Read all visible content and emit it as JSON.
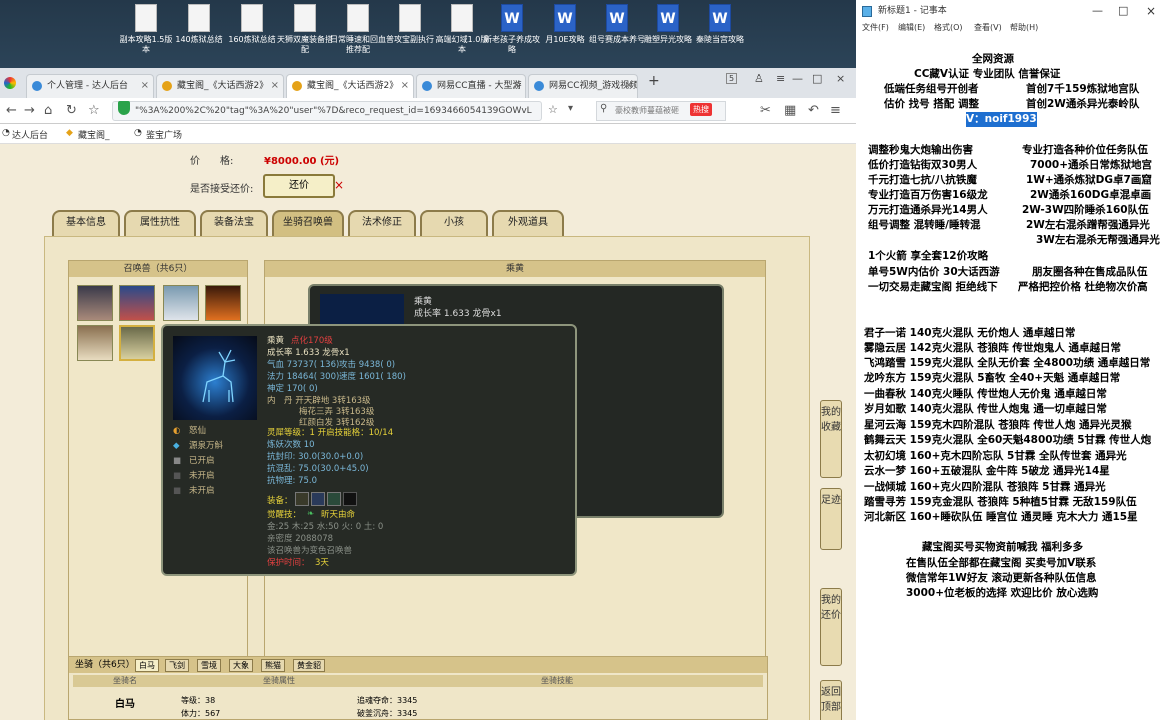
{
  "desktop": {
    "icons": [
      "副本攻略1.5版本",
      "140炼狱总结",
      "160炼狱总结",
      "天狮双魔装备搭配",
      "日常睡速和回血推荐配",
      "普攻宝副执行",
      "高端幻域1.0版本",
      "新老孩子养成攻略",
      "月10E攻略",
      "组号赛成本养号",
      "雕塑异光攻略",
      "秦陵当宫攻略"
    ]
  },
  "browser": {
    "tabs": [
      {
        "label": "个人管理 - 达人后台"
      },
      {
        "label": "藏宝阁_《大话西游2》"
      },
      {
        "label": "藏宝阁_《大话西游2》"
      },
      {
        "label": "网易CC直播 - 大型游"
      },
      {
        "label": "网易CC视频_游戏视频"
      }
    ],
    "tab_count": "5",
    "url": "\"%3A%200%2C%20\"tag\"%3A%20\"user\"%7D&reco_request_id=1693466054139GOWvL",
    "search_placeholder": "豪校教师蔓蕴被砸",
    "hot_badge": "热搜",
    "bookmarks": [
      "达人后台",
      "藏宝阁_",
      "鉴宝广场"
    ]
  },
  "page": {
    "price_label": "价　　格:",
    "price_value": "¥8000.00 (元)",
    "bargain_label": "是否接受还价:",
    "bargain_button": "还价",
    "tabs": [
      "基本信息",
      "属性抗性",
      "装备法宝",
      "坐骑召唤兽",
      "法术修正",
      "小孩",
      "外观道具"
    ],
    "pets_header": "召唤兽（共6只）",
    "detail_header": "乘黄",
    "tooltip_back": {
      "name": "乘黄",
      "growth": "成长率 1.633 龙骨x1"
    },
    "tooltip": {
      "name": "乘黄",
      "level": "点化170级",
      "growth": "成长率 1.633 龙骨x1",
      "hp": "气血 73737( 136)",
      "atk": "攻击 9438( 0)",
      "mp": "法力 18464( 300)",
      "spd": "速度 1601( 180)",
      "loyal": "神定 170( 0)",
      "neidan1": "内　丹 开天辟地 3转163级",
      "neidan2": "梅花三弄 3转163级",
      "neidan3": "红颜白发 3转162级",
      "skill1": "怒仙",
      "skill2": "源泉万斛",
      "skill3": "已开启",
      "skill4": "未开启",
      "skill5": "未开启",
      "lingxi": "灵犀等级：1 开启技能格：10/14",
      "lianyao": "炼妖次数 10",
      "kfy": "抗封印: 30.0(30.0+0.0)",
      "khl": "抗混乱: 75.0(30.0+45.0)",
      "kwl": "抗物理: 75.0",
      "equip": "装备：",
      "awaken": "觉醒技：",
      "awaken_skill": "昕天由命",
      "elements": "金:25 木:25 水:50 火: 0 土: 0",
      "qinmi": "亲密度 2088078",
      "note": "该召唤兽为变色召唤兽",
      "protect": "保护时间：",
      "protect_days": "3天"
    },
    "side_buttons": [
      "我的收藏",
      "足迹",
      "我的还价",
      "返回顶部"
    ],
    "mounts": {
      "header": "坐骑（共6只）",
      "tabs": [
        "白马",
        "飞剑",
        "雪境",
        "大象",
        "熊猫",
        "黄金貂"
      ],
      "cols": [
        "坐骑名",
        "坐骑属性",
        "坐骑技能"
      ],
      "name": "白马",
      "attr1": "等级：38",
      "attr2": "体力：567",
      "skill1": "追魂夺命：3345",
      "skill2": "破釜沉舟：3345"
    }
  },
  "notepad": {
    "title": "新标题1 - 记事本",
    "menu": [
      "文件(F)",
      "编辑(E)",
      "格式(O)",
      "查看(V)",
      "帮助(H)"
    ],
    "lines": [
      "全网资源",
      "CC藏V认证  专业团队  信誉保证",
      "低端任务组号开创者",
      "首创7千159炼狱地宫队",
      "估价 找号 搭配 调整",
      "首创2W通杀异光泰岭队",
      "V：noif1993",
      "调整秒鬼大炮输出伤害",
      "专业打造各种价位任务队伍",
      "低价打造钻街双30男人",
      "7000+通杀日常炼狱地宫",
      "千元打造七抗/八抗铁魔",
      "1W+通杀炼狱DG卓7画窟",
      "专业打造百万伤害16级龙",
      "2W通杀160DG卓混卓画",
      "万元打造通杀异光14男人",
      "2W-3W四阶睡杀160队伍",
      "组号调整 混转睡/睡转混",
      "2W左右混杀蹭帮强通异光",
      "3W左右混杀无帮强通异光",
      "1个火箭 享全套12价攻略",
      "单号5W内估价 30大话西游",
      "朋友圈各种在售成品队伍",
      "一切交易走藏宝阁 拒绝线下",
      "严格把控价格 杜绝物次价高",
      "君子一诺 140克火混队 无价炮人 通卓越日常",
      "雾隐云居 142克火混队 苍狼阵 传世炮鬼人 通卓越日常",
      "飞鸿踏雪 159克火混队 全队无价套 全4800功绩 通卓越日常",
      "龙吟东方 159克火混队 5畜牧 全40+天魁 通卓越日常",
      "一曲春秋 140克火睡队 传世炮人无价鬼 通卓越日常",
      "岁月如歌 140克火混队 传世人炮鬼 通一切卓越日常",
      "星河云海 159克木四阶混队 苍狼阵 传世人炮 通异光灵猴",
      "鹤舞云天 159克火混队 全60天魁4800功绩 5甘霖 传世人炮",
      "太初幻境 160+克木四阶忘队 5甘霖 全队传世套 通异光",
      "云水一梦 160+五破混队 金牛阵 5破龙 通异光14星",
      "一战倾城 160+克火四阶混队 苍狼阵 5甘霖 通异光",
      "踏雪寻芳 159克金混队 苍狼阵 5种植5甘霖 无敌159队伍",
      "河北新区 160+睡砍队伍 睡宫位 通灵睡 克木大力 通15星",
      "藏宝阁买号买物资前喊我 福利多多",
      "在售队伍全部都在藏宝阁 买卖号加V联系",
      "微信常年1W好友 滚动更新各种队伍信息",
      "3000+位老板的选择 欢迎比价 放心选购"
    ]
  },
  "colors": {
    "accent": "#c00",
    "highlight": "#1e6fd0",
    "tip_red": "#e04040",
    "tip_yellow": "#e6d23a"
  }
}
